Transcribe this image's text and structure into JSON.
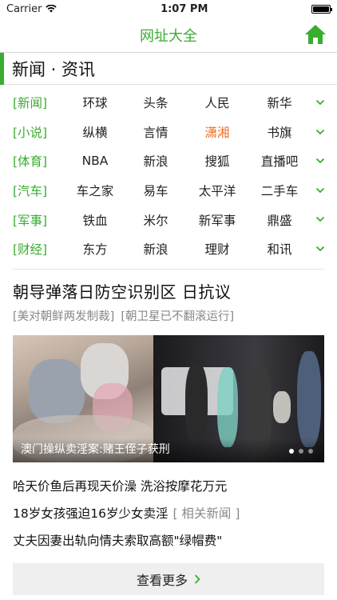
{
  "status": {
    "carrier": "Carrier",
    "time": "1:07 PM"
  },
  "navbar": {
    "title": "网址大全"
  },
  "section": {
    "title": "新闻 · 资讯"
  },
  "rows": [
    {
      "cat": "[新闻]",
      "sites": [
        "环球",
        "头条",
        "人民",
        "新华"
      ]
    },
    {
      "cat": "[小说]",
      "sites": [
        "纵横",
        "言情",
        "潇湘",
        "书旗"
      ]
    },
    {
      "cat": "[体育]",
      "sites": [
        "NBA",
        "新浪",
        "搜狐",
        "直播吧"
      ]
    },
    {
      "cat": "[汽车]",
      "sites": [
        "车之家",
        "易车",
        "太平洋",
        "二手车"
      ]
    },
    {
      "cat": "[军事]",
      "sites": [
        "铁血",
        "米尔",
        "新军事",
        "鼎盛"
      ]
    },
    {
      "cat": "[财经]",
      "sites": [
        "东方",
        "新浪",
        "理财",
        "和讯"
      ]
    }
  ],
  "headline": {
    "title": "朝导弹落日防空识别区 日抗议",
    "sub1": "[美对朝鲜两发制裁]",
    "sub2": "[朝卫星已不翻滚运行]"
  },
  "banner": {
    "caption": "澳门操纵卖淫案:赌王侄子获刑"
  },
  "news": [
    {
      "text": "哈天价鱼后再现天价澡 洗浴按摩花万元"
    },
    {
      "text": "18岁女孩强迫16岁少女卖淫",
      "related": "[ 相关新闻 ]"
    },
    {
      "text": "丈夫因妻出轨向情夫索取高额\"绿帽费\""
    }
  ],
  "more": {
    "label": "查看更多"
  },
  "colors": {
    "accent": "#3aad2f",
    "highlight": "#f26b1d"
  }
}
